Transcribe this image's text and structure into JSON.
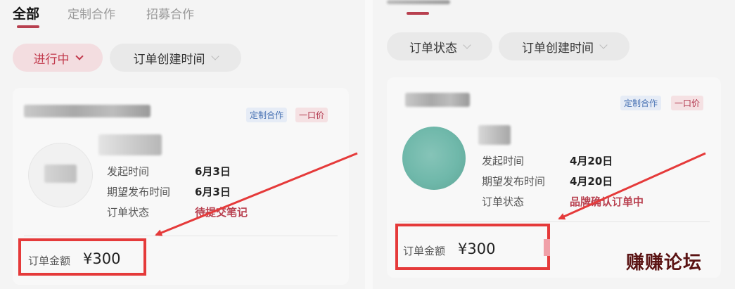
{
  "left": {
    "tabs": [
      {
        "label": "全部",
        "active": true
      },
      {
        "label": "定制合作",
        "active": false
      },
      {
        "label": "招募合作",
        "active": false
      }
    ],
    "filters": {
      "status_label": "进行中",
      "time_label": "订单创建时间"
    },
    "card": {
      "tags": [
        "定制合作",
        "一口价"
      ],
      "fields": [
        {
          "label": "发起时间",
          "value": "6月3日"
        },
        {
          "label": "期望发布时间",
          "value": "6月3日"
        },
        {
          "label": "订单状态",
          "value": "待提交笔记"
        }
      ],
      "amount_label": "订单金额",
      "amount_value": "¥300"
    }
  },
  "right": {
    "filters": {
      "status_label": "订单状态",
      "time_label": "订单创建时间"
    },
    "card": {
      "tags": [
        "定制合作",
        "一口价"
      ],
      "fields": [
        {
          "label": "发起时间",
          "value": "4月20日"
        },
        {
          "label": "期望发布时间",
          "value": "4月20日"
        },
        {
          "label": "订单状态",
          "value": "品牌确认订单中"
        }
      ],
      "amount_label": "订单金额",
      "amount_value": "¥300"
    }
  },
  "watermark": "赚赚论坛",
  "colors": {
    "accent": "#b8404f",
    "annotation_red": "#e53a3a",
    "avatar_teal": "#6fb8aa"
  }
}
